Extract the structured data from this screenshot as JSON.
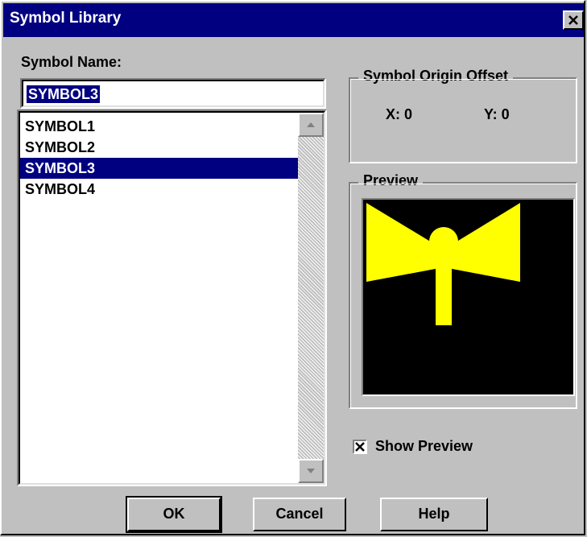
{
  "window": {
    "title": "Symbol Library",
    "close_icon": "close-icon"
  },
  "symbol_name": {
    "label": "Symbol Name:",
    "value": "SYMBOL3"
  },
  "symbol_list": {
    "items": [
      "SYMBOL1",
      "SYMBOL2",
      "SYMBOL3",
      "SYMBOL4"
    ],
    "selected": "SYMBOL3"
  },
  "origin_offset": {
    "title": "Symbol Origin Offset",
    "x_text": "X:  0",
    "y_text": "Y:  0"
  },
  "preview": {
    "title": "Preview",
    "background": "#000000",
    "symbol_color": "#ffff00"
  },
  "show_preview": {
    "label": "Show Preview",
    "checked": true
  },
  "buttons": {
    "ok": "OK",
    "cancel": "Cancel",
    "help": "Help"
  }
}
